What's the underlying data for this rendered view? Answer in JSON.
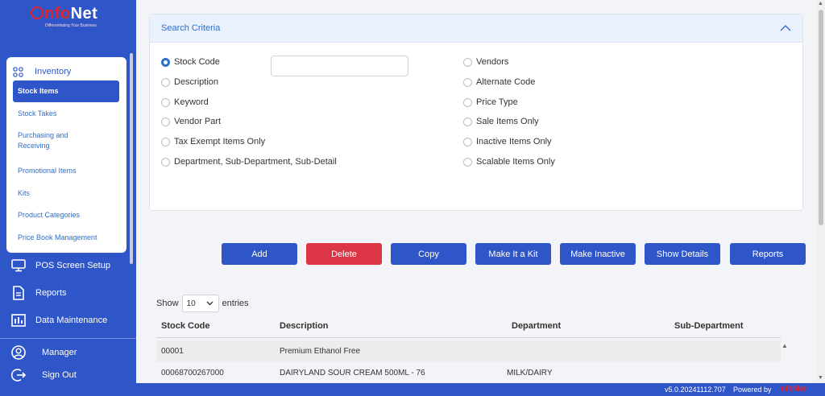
{
  "logo": {
    "text_prefix": "nfo",
    "text_suffix": "Net",
    "tagline": "Differentiating Your Business"
  },
  "sidebar": {
    "inventory_label": "Inventory",
    "items": [
      {
        "label": "Stock Items",
        "active": true
      },
      {
        "label": "Stock Takes"
      },
      {
        "label": "Purchasing and Receiving"
      },
      {
        "label": "Promotional Items"
      },
      {
        "label": "Kits"
      },
      {
        "label": "Product Categories"
      },
      {
        "label": "Price Book Management"
      }
    ],
    "nav": [
      {
        "label": "POS Screen Setup",
        "icon": "monitor-icon"
      },
      {
        "label": "Reports",
        "icon": "document-icon"
      },
      {
        "label": "Data Maintenance",
        "icon": "bar-chart-icon"
      }
    ],
    "bottom": [
      {
        "label": "Manager",
        "icon": "user-icon"
      },
      {
        "label": "Sign Out",
        "icon": "sign-out-icon"
      }
    ]
  },
  "search": {
    "title": "Search Criteria",
    "stock_code_value": "",
    "left_options": [
      "Stock Code",
      "Description",
      "Keyword",
      "Vendor Part",
      "Tax Exempt Items Only",
      "Department, Sub-Department, Sub-Detail"
    ],
    "right_options": [
      "Vendors",
      "Alternate Code",
      "Price Type",
      "Sale Items Only",
      "Inactive Items Only",
      "Scalable Items Only"
    ],
    "selected": "Stock Code"
  },
  "actions": [
    "Add",
    "Delete",
    "Copy",
    "Make It a Kit",
    "Make Inactive",
    "Show Details",
    "Reports"
  ],
  "table": {
    "show_label": "Show",
    "entries_value": "10",
    "entries_label": "entries",
    "columns": [
      "Stock Code",
      "Description",
      "Department",
      "Sub-Department"
    ],
    "rows": [
      [
        "00001",
        "Premium Ethanol Free",
        "",
        ""
      ],
      [
        "00068700267000",
        "DAIRYLAND SOUR CREAM 500ML - 76",
        "MILK/DAIRY",
        ""
      ]
    ]
  },
  "footer": {
    "version": "v5.0.20241112.707",
    "powered": "Powered by",
    "brand_prefix": "nfo",
    "brand_suffix": "Net"
  },
  "colors": {
    "primary": "#2f56c9",
    "danger": "#dc3545",
    "accent_link": "#2f6fc9",
    "logo_red": "#e0242b"
  }
}
